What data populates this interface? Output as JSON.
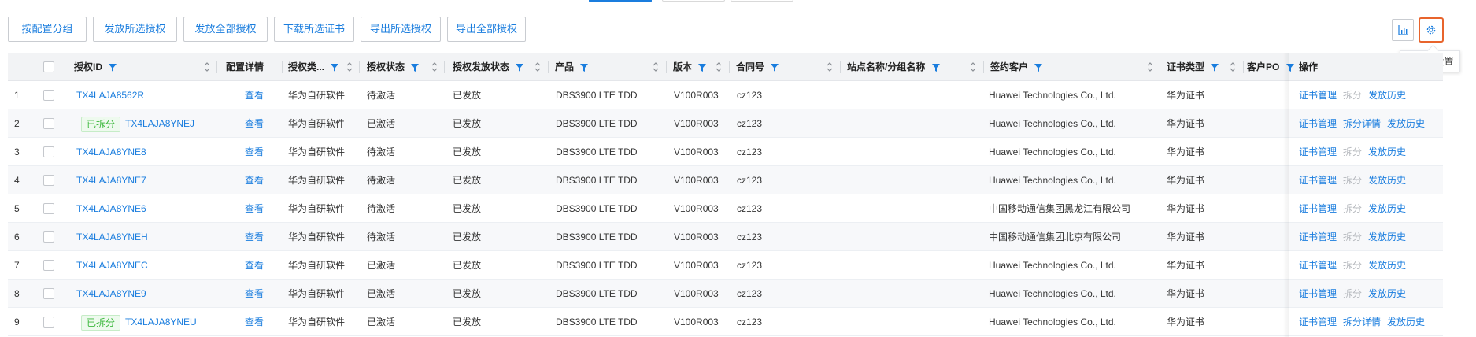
{
  "toolbar": {
    "buttons": [
      "按配置分组",
      "发放所选授权",
      "发放全部授权",
      "下载所选证书",
      "导出所选授权",
      "导出全部授权"
    ]
  },
  "settings_tooltip": "个性化设置",
  "icons": {
    "chart": "bar-chart-icon",
    "settings": "gear-icon",
    "filter": "filter-funnel-icon",
    "sort": "sort-arrows-icon"
  },
  "colors": {
    "accent": "#1a7dde",
    "badge_green": "#3db83e",
    "highlight": "#e8642c"
  },
  "table": {
    "headers": {
      "license_id": "授权ID",
      "config_detail": "配置详情",
      "license_type": "授权类...",
      "license_status": "授权状态",
      "issue_status": "授权发放状态",
      "product": "产品",
      "version": "版本",
      "contract": "合同号",
      "site": "站点名称/分组名称",
      "customer": "签约客户",
      "cert_type": "证书类型",
      "customer_po": "客户PO",
      "ops": "操作"
    },
    "rows": [
      {
        "no": "1",
        "badge": "",
        "license_id": "TX4LAJA8562R",
        "config_detail": "查看",
        "license_type": "华为自研软件",
        "license_status": "待激活",
        "issue_status": "已发放",
        "product": "DBS3900 LTE TDD",
        "version": "V100R003",
        "contract": "cz123",
        "site": "",
        "customer": "Huawei Technologies Co., Ltd.",
        "cert_type": "华为证书",
        "customer_po": "",
        "op1": "证书管理",
        "op2": "拆分",
        "op3": "发放历史",
        "op2_active": false
      },
      {
        "no": "2",
        "badge": "已拆分",
        "license_id": "TX4LAJA8YNEJ",
        "config_detail": "查看",
        "license_type": "华为自研软件",
        "license_status": "已激活",
        "issue_status": "已发放",
        "product": "DBS3900 LTE TDD",
        "version": "V100R003",
        "contract": "cz123",
        "site": "",
        "customer": "Huawei Technologies Co., Ltd.",
        "cert_type": "华为证书",
        "customer_po": "",
        "op1": "证书管理",
        "op2": "拆分详情",
        "op3": "发放历史",
        "op2_active": true
      },
      {
        "no": "3",
        "badge": "",
        "license_id": "TX4LAJA8YNE8",
        "config_detail": "查看",
        "license_type": "华为自研软件",
        "license_status": "待激活",
        "issue_status": "已发放",
        "product": "DBS3900 LTE TDD",
        "version": "V100R003",
        "contract": "cz123",
        "site": "",
        "customer": "Huawei Technologies Co., Ltd.",
        "cert_type": "华为证书",
        "customer_po": "",
        "op1": "证书管理",
        "op2": "拆分",
        "op3": "发放历史",
        "op2_active": false
      },
      {
        "no": "4",
        "badge": "",
        "license_id": "TX4LAJA8YNE7",
        "config_detail": "查看",
        "license_type": "华为自研软件",
        "license_status": "待激活",
        "issue_status": "已发放",
        "product": "DBS3900 LTE TDD",
        "version": "V100R003",
        "contract": "cz123",
        "site": "",
        "customer": "Huawei Technologies Co., Ltd.",
        "cert_type": "华为证书",
        "customer_po": "",
        "op1": "证书管理",
        "op2": "拆分",
        "op3": "发放历史",
        "op2_active": false
      },
      {
        "no": "5",
        "badge": "",
        "license_id": "TX4LAJA8YNE6",
        "config_detail": "查看",
        "license_type": "华为自研软件",
        "license_status": "待激活",
        "issue_status": "已发放",
        "product": "DBS3900 LTE TDD",
        "version": "V100R003",
        "contract": "cz123",
        "site": "",
        "customer": "中国移动通信集团黑龙江有限公司",
        "cert_type": "华为证书",
        "customer_po": "",
        "op1": "证书管理",
        "op2": "拆分",
        "op3": "发放历史",
        "op2_active": false
      },
      {
        "no": "6",
        "badge": "",
        "license_id": "TX4LAJA8YNEH",
        "config_detail": "查看",
        "license_type": "华为自研软件",
        "license_status": "待激活",
        "issue_status": "已发放",
        "product": "DBS3900 LTE TDD",
        "version": "V100R003",
        "contract": "cz123",
        "site": "",
        "customer": "中国移动通信集团北京有限公司",
        "cert_type": "华为证书",
        "customer_po": "",
        "op1": "证书管理",
        "op2": "拆分",
        "op3": "发放历史",
        "op2_active": false
      },
      {
        "no": "7",
        "badge": "",
        "license_id": "TX4LAJA8YNEC",
        "config_detail": "查看",
        "license_type": "华为自研软件",
        "license_status": "已激活",
        "issue_status": "已发放",
        "product": "DBS3900 LTE TDD",
        "version": "V100R003",
        "contract": "cz123",
        "site": "",
        "customer": "Huawei Technologies Co., Ltd.",
        "cert_type": "华为证书",
        "customer_po": "",
        "op1": "证书管理",
        "op2": "拆分",
        "op3": "发放历史",
        "op2_active": false
      },
      {
        "no": "8",
        "badge": "",
        "license_id": "TX4LAJA8YNE9",
        "config_detail": "查看",
        "license_type": "华为自研软件",
        "license_status": "已激活",
        "issue_status": "已发放",
        "product": "DBS3900 LTE TDD",
        "version": "V100R003",
        "contract": "cz123",
        "site": "",
        "customer": "Huawei Technologies Co., Ltd.",
        "cert_type": "华为证书",
        "customer_po": "",
        "op1": "证书管理",
        "op2": "拆分",
        "op3": "发放历史",
        "op2_active": false
      },
      {
        "no": "9",
        "badge": "已拆分",
        "license_id": "TX4LAJA8YNEU",
        "config_detail": "查看",
        "license_type": "华为自研软件",
        "license_status": "已激活",
        "issue_status": "已发放",
        "product": "DBS3900 LTE TDD",
        "version": "V100R003",
        "contract": "cz123",
        "site": "",
        "customer": "Huawei Technologies Co., Ltd.",
        "cert_type": "华为证书",
        "customer_po": "",
        "op1": "证书管理",
        "op2": "拆分详情",
        "op3": "发放历史",
        "op2_active": true
      }
    ]
  }
}
